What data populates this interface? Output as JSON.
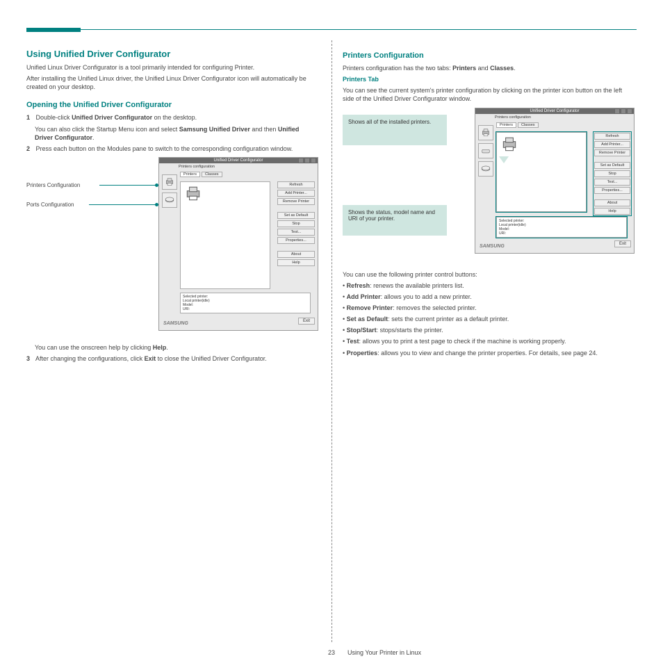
{
  "header": {},
  "left": {
    "h2": "Using Unified Driver Configurator",
    "intro1": "Unified Linux Driver Configurator is a tool primarily intended for configuring Printer.",
    "intro2": "After installing the Unified Linux driver, the Unified Linux Driver Configurator icon will automatically be created on your desktop.",
    "open_h3": "Opening the Unified Driver Configurator",
    "step1_num": "1",
    "step1_txt": "Double-click Unified Driver Configurator on the desktop.",
    "step1_alt": "You can also click the Startup Menu icon and select Samsung Unified Driver and then Unified Driver Configurator.",
    "step2_num": "2",
    "step2_txt": "Press each button on the Modules pane to switch to the corresponding configuration window.",
    "label_printers": "Printers Configuration",
    "label_ports": "Ports Configuration",
    "help_line": "You can use the onscreen help by clicking Help.",
    "step3_num": "3",
    "step3_txt": "After changing the configurations, click Exit to close the Unified Driver Configurator."
  },
  "right": {
    "h3": "Printers Configuration",
    "intro": "Printers configuration has the two tabs: Printers and Classes.",
    "tab_h": "Printers Tab",
    "tab_txt": "You can see the current system's printer configuration by clicking on the printer icon button on the left side of the Unified Driver Configurator window.",
    "callout1": "Shows all of the installed printers.",
    "callout2": "Shows the status, model name and URI of your printer.",
    "btns_p": "You can use the following printer control buttons:",
    "bul1_b": "Refresh",
    "bul1_t": ": renews the available printers list.",
    "bul2_b": "Add Printer",
    "bul2_t": ": allows you to add a new printer.",
    "bul3_b": "Remove Printer",
    "bul3_t": ": removes the selected printer.",
    "bul4_b": "Set as Default",
    "bul4_t": ": sets the current printer as a default printer.",
    "bul5_b": "Stop/Start",
    "bul5_t": ": stops/starts the printer.",
    "bul6_b": "Test",
    "bul6_t": ": allows you to print a test page to check if the machine is working properly.",
    "bul7_b": "Properties",
    "bul7_t": ": allows you to view and change the printer properties. For details, see page 24."
  },
  "cfg": {
    "title": "Unified Driver Configurator",
    "conf_label": "Printers configuration",
    "tab_printers": "Printers",
    "tab_classes": "Classes",
    "btn_refresh": "Refresh",
    "btn_add": "Add Printer...",
    "btn_remove": "Remove Printer",
    "btn_default": "Set as Default",
    "btn_stop": "Stop",
    "btn_test": "Test...",
    "btn_props": "Properties...",
    "btn_about": "About",
    "btn_help": "Help",
    "btn_exit": "Exit",
    "info_sel": "Selected printer:",
    "info_local": "Local printer(idle)",
    "info_model": "Model:",
    "info_uri": "URI:",
    "logo": "SAMSUNG"
  },
  "footer": {
    "page": "23",
    "caption": "Using Your Printer in Linux"
  }
}
